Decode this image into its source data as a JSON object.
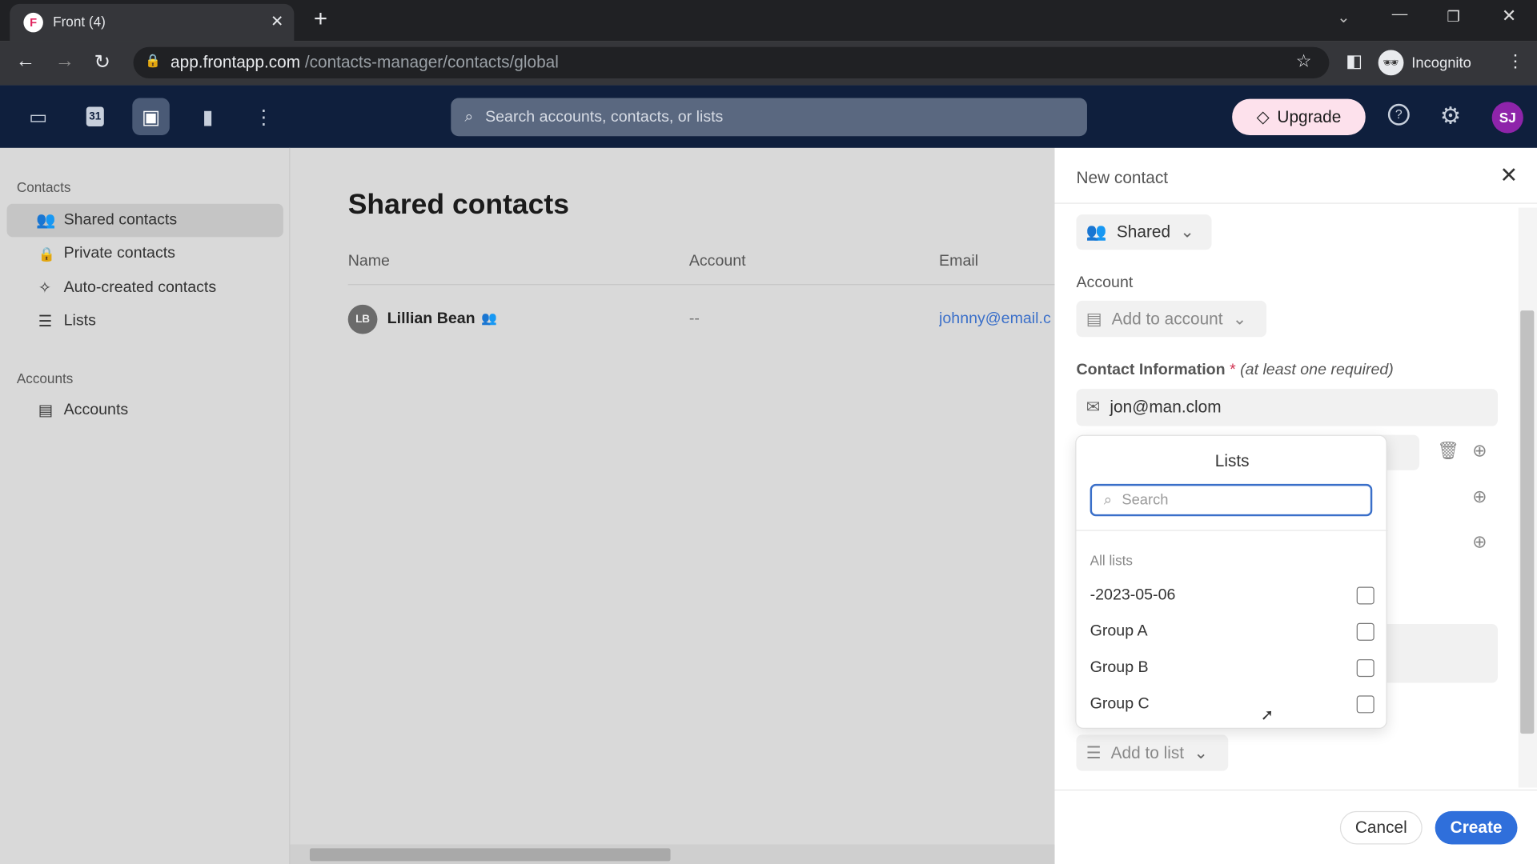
{
  "browser": {
    "tab_title": "Front (4)",
    "url_host": "app.frontapp.com",
    "url_path": "/contacts-manager/contacts/global",
    "incognito": "Incognito"
  },
  "appbar": {
    "search_placeholder": "Search accounts, contacts, or lists",
    "upgrade": "Upgrade",
    "avatar": "SJ",
    "calendar_day": "31"
  },
  "sidebar": {
    "contacts_header": "Contacts",
    "items": [
      {
        "label": "Shared contacts"
      },
      {
        "label": "Private contacts"
      },
      {
        "label": "Auto-created contacts"
      },
      {
        "label": "Lists"
      }
    ],
    "accounts_header": "Accounts",
    "accounts_item": "Accounts"
  },
  "main": {
    "title": "Shared contacts",
    "columns": [
      "Name",
      "Account",
      "Email"
    ],
    "rows": [
      {
        "initials": "LB",
        "name": "Lillian Bean",
        "account": "--",
        "email": "johnny@email.c"
      }
    ]
  },
  "panel": {
    "title": "New contact",
    "visibility": "Shared",
    "account_label": "Account",
    "account_button": "Add to account",
    "contact_info_label": "Contact Information",
    "required_mark": "*",
    "required_hint": "(at least one required)",
    "email_value": "jon@man.clom",
    "add_to_list": "Add to list",
    "cancel": "Cancel",
    "create": "Create"
  },
  "lists_popup": {
    "title": "Lists",
    "search_placeholder": "Search",
    "section": "All lists",
    "items": [
      {
        "label": "-2023-05-06",
        "checked": false
      },
      {
        "label": "Group A",
        "checked": false
      },
      {
        "label": "Group B",
        "checked": false
      },
      {
        "label": "Group C",
        "checked": false
      }
    ]
  },
  "colors": {
    "accent": "#2f6fdb",
    "appbar": "#0f1f3d",
    "link": "#3a6fc9"
  }
}
